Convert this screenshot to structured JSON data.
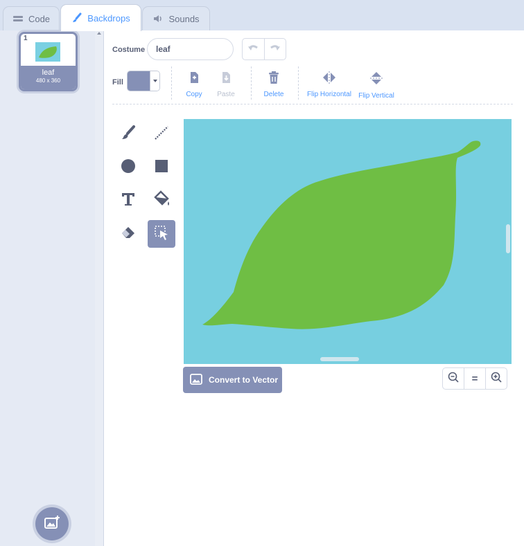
{
  "tabs": [
    {
      "label": "Code",
      "icon": "code-icon"
    },
    {
      "label": "Backdrops",
      "icon": "brush-icon",
      "active": true
    },
    {
      "label": "Sounds",
      "icon": "speaker-icon"
    }
  ],
  "costume_list": {
    "items": [
      {
        "number": "1",
        "name": "leaf",
        "size": "480 x 360"
      }
    ],
    "add_button_icon": "add-backdrop-icon"
  },
  "editor": {
    "costume_label": "Costume",
    "costume_name": "leaf",
    "fill_label": "Fill",
    "fill_color": "#8590b6",
    "actions": {
      "copy": "Copy",
      "paste": "Paste",
      "delete": "Delete",
      "flip_horizontal": "Flip Horizontal",
      "flip_vertical": "Flip Vertical"
    },
    "convert_label": "Convert to Vector",
    "zoom_reset_label": "="
  },
  "colors": {
    "accent": "#4c97ff",
    "canvas_bg": "#77cfe0",
    "leaf": "#6fbe44",
    "selected": "#8590b6"
  }
}
